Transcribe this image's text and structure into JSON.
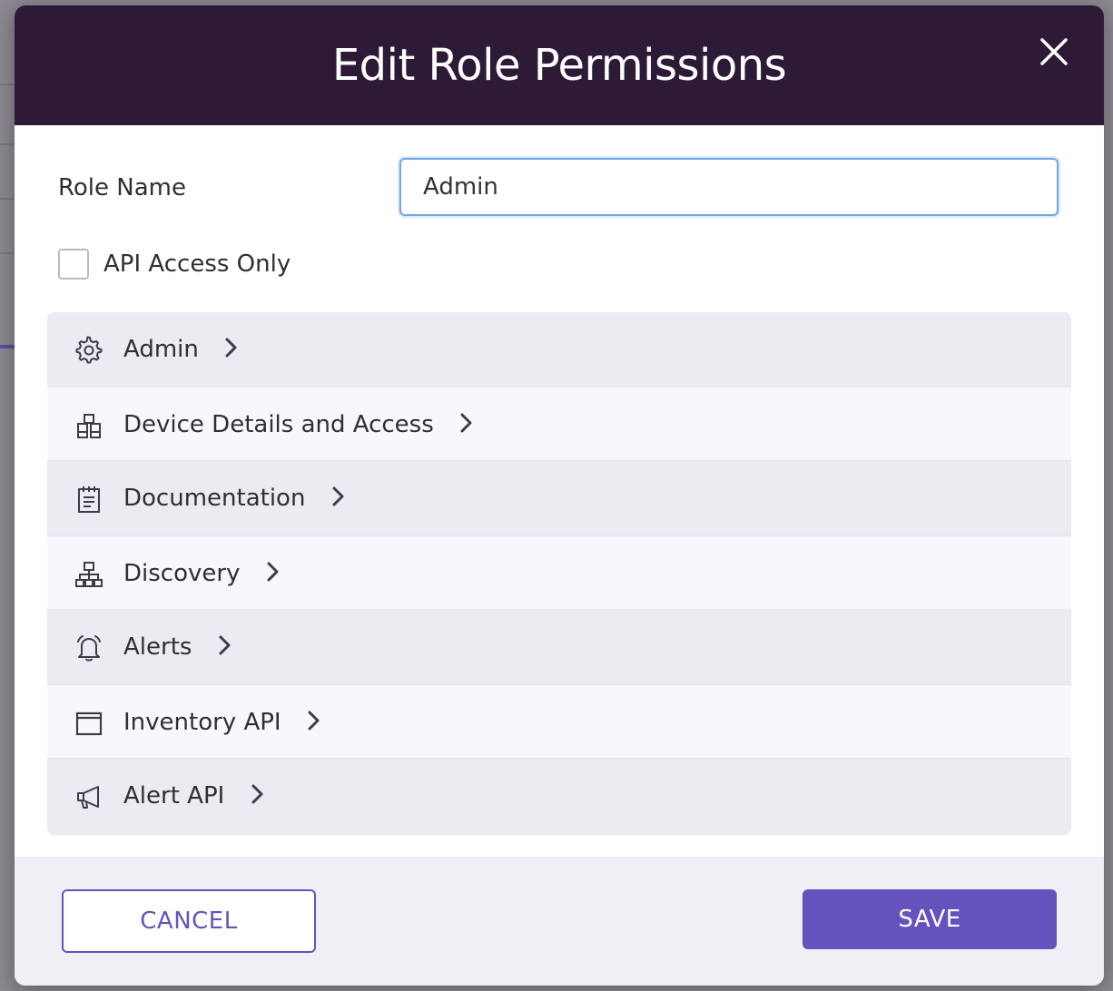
{
  "modal": {
    "title": "Edit Role Permissions",
    "close_icon": "close-icon"
  },
  "form": {
    "role_name_label": "Role Name",
    "role_name_value": "Admin",
    "api_access_label": "API Access Only",
    "api_access_checked": false
  },
  "permissions": [
    {
      "label": "Admin",
      "icon": "gear-icon"
    },
    {
      "label": "Device Details and Access",
      "icon": "cubes-icon"
    },
    {
      "label": "Documentation",
      "icon": "clipboard-icon"
    },
    {
      "label": "Discovery",
      "icon": "network-icon"
    },
    {
      "label": "Alerts",
      "icon": "bell-icon"
    },
    {
      "label": "Inventory API",
      "icon": "window-icon"
    },
    {
      "label": "Alert API",
      "icon": "megaphone-icon"
    }
  ],
  "footer": {
    "cancel_label": "CANCEL",
    "save_label": "SAVE"
  },
  "colors": {
    "header_bg": "#2c1a37",
    "accent": "#6652bd",
    "input_focus": "#6ea6e8"
  }
}
